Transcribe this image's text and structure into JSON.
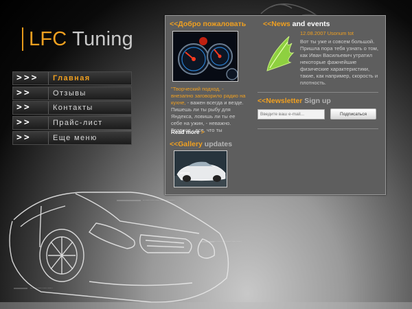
{
  "brand": {
    "part1": "LFC",
    "part2": "Tuning"
  },
  "nav": [
    {
      "arrows": ">>>",
      "label": "Главная",
      "active": true
    },
    {
      "arrows": ">>",
      "label": "Отзывы"
    },
    {
      "arrows": ">>",
      "label": "Контакты"
    },
    {
      "arrows": ">>",
      "label": "Прайс-лист"
    },
    {
      "arrows": ">>",
      "label": "Еще меню"
    }
  ],
  "welcome": {
    "mark": "<<",
    "title": "Добро пожаловать",
    "quote": "\"Творческий подход, - внезапно заговорило радио на кухне,",
    "body": " - важен всегда и везде. Пишешь ли ты рыбу для Яндекса, ловишь ли ты ее себе на ужин, - неважно. Главное - все, что ты",
    "read_more": "Read more",
    "read_more_mark": ">"
  },
  "news": {
    "mark": "<<",
    "title_a": "News",
    "title_b": "and events",
    "date": "12.08.2007 Usonum tot",
    "body": "Вот ты уже и совсем большой. Пришла пора тебя узнать о том, как Иван Васильевич утратил некоторые фажнейшие физические характеристики, такие, как например, скорость и плотность."
  },
  "newsletter": {
    "mark": "<<",
    "title_a": "Newsletter",
    "title_b": "Sign up",
    "placeholder": "Введите ваш e-mail...",
    "button": "Подписаться"
  },
  "gallery": {
    "mark": "<<",
    "title_a": "Gallery",
    "title_b": "updates"
  },
  "colors": {
    "accent": "#f0a020",
    "panel": "#5e5e5e"
  },
  "icons": {
    "news": "green-wing-icon",
    "welcome": "dashboard-gauges-image",
    "gallery": "car-photo-image"
  }
}
